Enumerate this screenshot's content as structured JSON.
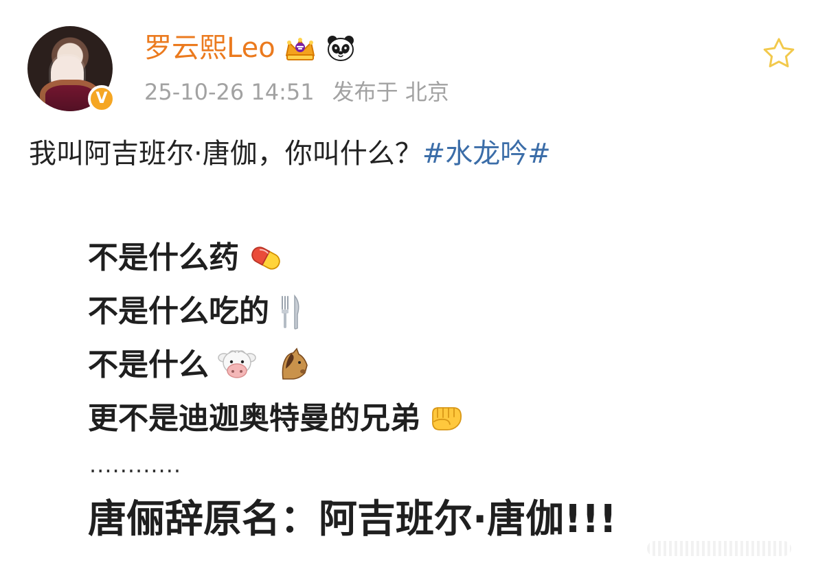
{
  "header": {
    "username": "罗云熙Leo",
    "timestamp": "25-10-26 14:51",
    "location_label": "发布于 北京",
    "verified_badge_text": "V"
  },
  "post": {
    "text_prefix": "我叫阿吉班尔·唐伽，你叫什么？",
    "hashtag": "#水龙吟#"
  },
  "image_card": {
    "lines": [
      "不是什么药",
      "不是什么吃的",
      "不是什么",
      "更不是迪迦奥特曼的兄弟"
    ],
    "dots": "............",
    "final_line": "唐俪辞原名：阿吉班尔·唐伽!!!"
  },
  "icons": {
    "crown_icon": "crown-icon",
    "panda_icon": "panda-icon",
    "star_icon": "star-icon",
    "pill_icon": "pill-icon",
    "utensils_icon": "utensils-icon",
    "cow_icon": "cow-icon",
    "horse_icon": "horse-icon",
    "fist_icon": "fist-icon"
  },
  "colors": {
    "username": "#eb7a1e",
    "hashtag": "#3b6da8",
    "meta": "#a2a2a2",
    "verified_badge": "#f5a623",
    "star_outline": "#f2c94c"
  }
}
